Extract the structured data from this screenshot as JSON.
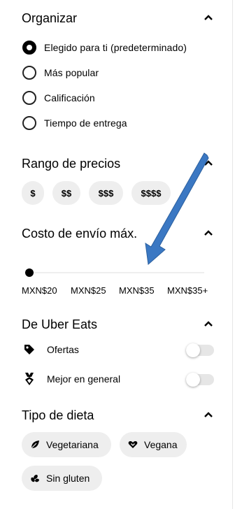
{
  "sort": {
    "title": "Organizar",
    "options": [
      {
        "label": "Elegido para ti (predeterminado)",
        "selected": true
      },
      {
        "label": "Más popular",
        "selected": false
      },
      {
        "label": "Calificación",
        "selected": false
      },
      {
        "label": "Tiempo de entrega",
        "selected": false
      }
    ]
  },
  "price": {
    "title": "Rango de precios",
    "chips": [
      "$",
      "$$",
      "$$$",
      "$$$$"
    ]
  },
  "delivery": {
    "title": "Costo de envío máx.",
    "ticks": [
      "MXN$20",
      "MXN$25",
      "MXN$35",
      "MXN$35+"
    ],
    "selected_index": 0
  },
  "uber": {
    "title": "De Uber Eats",
    "items": [
      {
        "label": "Ofertas",
        "icon": "tag-icon",
        "enabled": false
      },
      {
        "label": "Mejor en general",
        "icon": "medal-icon",
        "enabled": false
      }
    ]
  },
  "diet": {
    "title": "Tipo de dieta",
    "chips": [
      {
        "label": "Vegetariana",
        "icon": "leaf-icon"
      },
      {
        "label": "Vegana",
        "icon": "heart-icon"
      },
      {
        "label": "Sin gluten",
        "icon": "grain-icon"
      }
    ]
  },
  "annotation": {
    "color": "#3b78c3",
    "icon": "arrow-annotation"
  }
}
